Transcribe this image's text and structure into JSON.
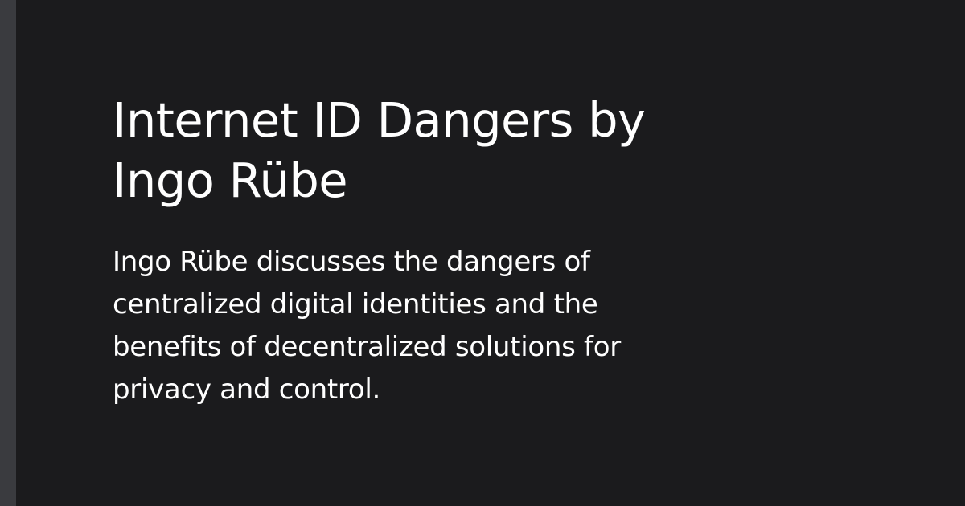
{
  "card": {
    "title": "Internet ID Dangers by Ingo Rübe",
    "description": "Ingo Rübe discusses the dangers of centralized digital identities and the benefits of decentralized solutions for privacy and control."
  },
  "colors": {
    "background": "#1b1b1d",
    "accent_bar": "#3a3b3f",
    "text": "#ffffff"
  }
}
